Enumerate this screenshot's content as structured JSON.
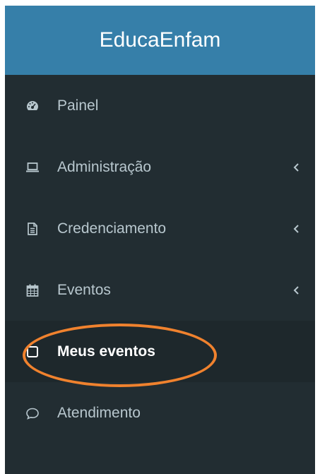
{
  "brand": {
    "title": "EducaEnfam"
  },
  "menu": {
    "items": [
      {
        "label": "Painel",
        "icon": "dashboard-icon",
        "has_submenu": false,
        "active": false
      },
      {
        "label": "Administração",
        "icon": "laptop-icon",
        "has_submenu": true,
        "active": false
      },
      {
        "label": "Credenciamento",
        "icon": "file-text-icon",
        "has_submenu": true,
        "active": false
      },
      {
        "label": "Eventos",
        "icon": "calendar-icon",
        "has_submenu": true,
        "active": false
      },
      {
        "label": "Meus eventos",
        "icon": "square-icon",
        "has_submenu": false,
        "active": true
      },
      {
        "label": "Atendimento",
        "icon": "comment-icon",
        "has_submenu": false,
        "active": false
      }
    ]
  },
  "colors": {
    "sidebar_bg": "#222d32",
    "brand_bg": "#367fa9",
    "active_bg": "#1e282c",
    "text": "#b8c7ce",
    "highlight": "#f0822e"
  }
}
